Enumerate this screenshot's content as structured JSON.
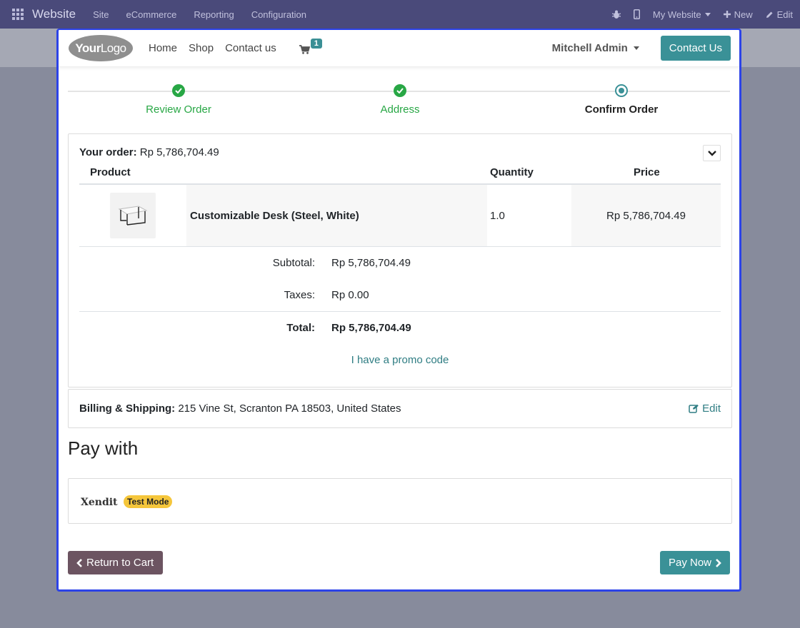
{
  "topbar": {
    "app_name": "Website",
    "menu": [
      "Site",
      "eCommerce",
      "Reporting",
      "Configuration"
    ],
    "website_selector": "My Website",
    "new_label": "New",
    "edit_label": "Edit"
  },
  "header": {
    "logo_text_bold": "Your",
    "logo_text": "Logo",
    "nav": [
      "Home",
      "Shop",
      "Contact us"
    ],
    "cart_count": "1",
    "user_name": "Mitchell Admin",
    "contact_button": "Contact Us"
  },
  "wizard": {
    "steps": [
      {
        "label": "Review Order",
        "state": "done"
      },
      {
        "label": "Address",
        "state": "done"
      },
      {
        "label": "Confirm Order",
        "state": "current"
      }
    ]
  },
  "order": {
    "title_label": "Your order:",
    "title_amount": "Rp 5,786,704.49",
    "columns": {
      "product": "Product",
      "quantity": "Quantity",
      "price": "Price"
    },
    "line": {
      "name": "Customizable Desk (Steel, White)",
      "quantity": "1.0",
      "price": "Rp 5,786,704.49"
    },
    "subtotal_label": "Subtotal:",
    "subtotal_value": "Rp 5,786,704.49",
    "taxes_label": "Taxes:",
    "taxes_value": "Rp 0.00",
    "total_label": "Total:",
    "total_value": "Rp 5,786,704.49",
    "promo_link": "I have a promo code"
  },
  "billing": {
    "label": "Billing & Shipping:",
    "address": "215 Vine St, Scranton PA 18503, United States",
    "edit_label": "Edit"
  },
  "payment": {
    "title": "Pay with",
    "provider": "Xendit",
    "mode_badge": "Test Mode"
  },
  "actions": {
    "back_label": "Return to Cart",
    "pay_label": "Pay Now"
  },
  "colors": {
    "primary": "#3a9197",
    "success": "#28a745",
    "frame_border": "#2c43e8",
    "back_button": "#6c5461",
    "badge_warning": "#f5c63b"
  }
}
